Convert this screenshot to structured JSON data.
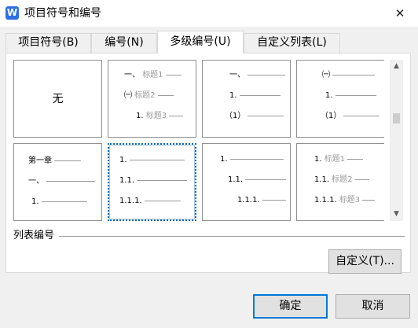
{
  "window": {
    "title": "项目符号和编号",
    "app_icon_glyph": "W",
    "close_glyph": "✕"
  },
  "tabs": [
    {
      "label": "项目符号(B)"
    },
    {
      "label": "编号(N)"
    },
    {
      "label": "多级编号(U)",
      "active": true
    },
    {
      "label": "自定义列表(L)"
    }
  ],
  "gallery": {
    "none_label": "无",
    "tiles": [
      {
        "lines": []
      },
      {
        "lines": [
          {
            "prefix": "一、",
            "label": "标题1"
          },
          {
            "prefix": "㈠",
            "label": "标题2"
          },
          {
            "prefix": "1.",
            "label": "标题3"
          }
        ]
      },
      {
        "lines": [
          {
            "prefix": "一、",
            "label": ""
          },
          {
            "prefix": "1.",
            "label": ""
          },
          {
            "prefix": "（1）",
            "label": ""
          }
        ]
      },
      {
        "lines": [
          {
            "prefix": "㈠",
            "label": ""
          },
          {
            "prefix": "1.",
            "label": ""
          },
          {
            "prefix": "（1）",
            "label": ""
          }
        ]
      },
      {
        "lines": [
          {
            "prefix": "第一章",
            "label": ""
          },
          {
            "prefix": "一、",
            "label": ""
          },
          {
            "prefix": "1.",
            "label": ""
          }
        ]
      },
      {
        "selected": true,
        "lines": [
          {
            "prefix": "1.",
            "label": ""
          },
          {
            "prefix": "1.1.",
            "label": ""
          },
          {
            "prefix": "1.1.1.",
            "label": ""
          }
        ]
      },
      {
        "lines": [
          {
            "prefix": "1.",
            "label": ""
          },
          {
            "prefix": "1.1.",
            "label": ""
          },
          {
            "prefix": "1.1.1.",
            "label": ""
          }
        ]
      },
      {
        "lines": [
          {
            "prefix": "1.",
            "label": "标题1"
          },
          {
            "prefix": "1.1.",
            "label": "标题2"
          },
          {
            "prefix": "1.1.1.",
            "label": "标题3"
          }
        ]
      }
    ]
  },
  "scrollbar": {
    "up_glyph": "▲",
    "down_glyph": "▼"
  },
  "list_section": {
    "label": "列表编号",
    "customize_button": "自定义(T)..."
  },
  "footer": {
    "ok_label": "确定",
    "cancel_label": "取消"
  }
}
